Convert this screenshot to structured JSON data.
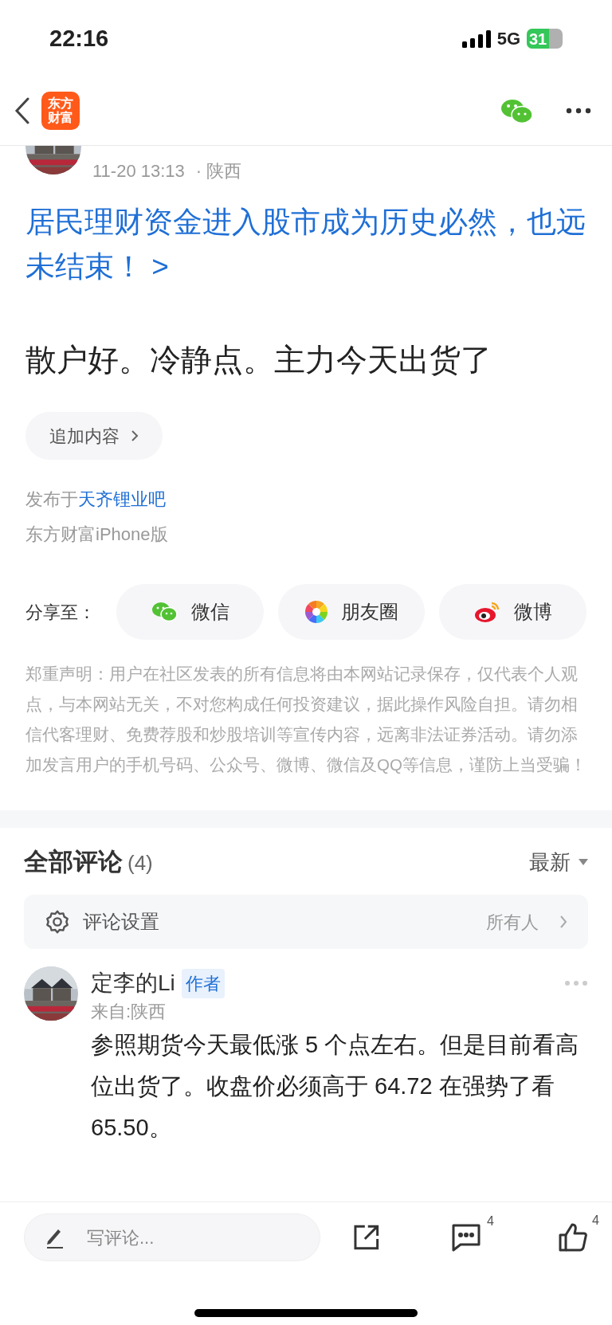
{
  "status_bar": {
    "time": "22:16",
    "network": "5G",
    "battery": "31"
  },
  "header": {
    "logo_lines": [
      "东方",
      "财富"
    ]
  },
  "post": {
    "date": "11-20 13:13",
    "location": "· 陕西",
    "title_link": "居民理财资金进入股市成为历史必然，也远未结束！ >",
    "body": "散户好。冷静点。主力今天出货了",
    "append_button": "追加内容",
    "published_prefix": "发布于",
    "forum": "天齐锂业吧",
    "client": "东方财富iPhone版",
    "share": {
      "label": "分享至：",
      "targets": [
        {
          "kind": "wechat",
          "label": "微信"
        },
        {
          "kind": "moments",
          "label": "朋友圈"
        },
        {
          "kind": "weibo",
          "label": "微博"
        }
      ]
    },
    "disclaimer": "郑重声明：用户在社区发表的所有信息将由本网站记录保存，仅代表个人观点，与本网站无关，不对您构成任何投资建议，据此操作风险自担。请勿相信代客理财、免费荐股和炒股培训等宣传内容，远离非法证券活动。请勿添加发言用户的手机号码、公众号、微博、微信及QQ等信息，谨防上当受骗！"
  },
  "comments": {
    "heading": "全部评论",
    "count": "(4)",
    "sort": "最新",
    "settings": {
      "label": "评论设置",
      "value": "所有人"
    },
    "items": [
      {
        "author": "定李的Li",
        "badge": "作者",
        "from": "来自:陕西",
        "text": "参照期货今天最低涨 5 个点左右。但是目前看高位出货了。收盘价必须高于 64.72 在强势了看 65.50。"
      }
    ]
  },
  "bottom_bar": {
    "placeholder": "写评论...",
    "comment_count": "4",
    "like_count": "4"
  }
}
